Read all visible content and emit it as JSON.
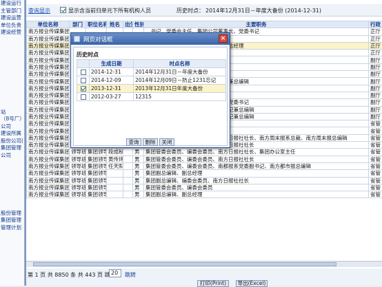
{
  "left_nav": {
    "items": [
      "建设运行",
      "主管部门",
      "建设运营",
      "单位负责",
      "建设经营",
      "",
      "",
      "",
      "",
      "",
      "",
      "",
      "",
      "",
      "",
      "站",
      "（8号厂）",
      "公司",
      "建设所属",
      "股份公司(",
      "集团管理",
      "公司",
      "",
      "",
      "",
      "",
      "",
      "",
      "",
      "股份管理",
      "集团管理",
      "管理计划"
    ]
  },
  "query_bar": {
    "link": "查询显示",
    "checkbox_label": "显示含当前归单元下所有机构人员",
    "history_label": "历史时点：",
    "history_value": "2014年12月31日－年度大备份 (2014-12-31)"
  },
  "table": {
    "headers": [
      "单位名称",
      "部门",
      "职位名称",
      "姓名",
      "出生",
      "性别",
      "主要职务",
      "行政"
    ],
    "rows": [
      {
        "c": [
          "南方报业传媒集团",
          "",
          "",
          "",
          "",
          "",
          "…书记、党委会主任、集团公司董事长、党委书记",
          "正厅"
        ],
        "hl": false
      },
      {
        "c": [
          "南方报业传媒集团",
          "",
          "",
          "",
          "",
          "",
          "…集团副总编辑、南方日报社社长",
          "正厅"
        ],
        "hl": false
      },
      {
        "c": [
          "南方报业传媒集团",
          "",
          "",
          "",
          "",
          "",
          "…工作；集团公司党委书记、董事、总经理",
          "正厅"
        ],
        "hl": true
      },
      {
        "c": [
          "南方报业传媒集团",
          "",
          "",
          "",
          "",
          "",
          "…集团副总编辑、南方日报社总编辑",
          "正厅"
        ],
        "hl": false
      },
      {
        "c": [
          "南方报业传媒集团",
          "",
          "",
          "",
          "",
          "",
          "管理会副主任",
          "副厅"
        ],
        "hl": false
      },
      {
        "c": [
          "南方报业传媒集团",
          "",
          "",
          "",
          "",
          "",
          "集团副总编辑、南方都市报总编辑",
          "副厅"
        ],
        "hl": false
      },
      {
        "c": [
          "南方报业传媒集团",
          "",
          "",
          "",
          "",
          "",
          "集团副总编辑、南方日报社副总编辑",
          "副厅"
        ],
        "hl": false
      },
      {
        "c": [
          "南方报业传媒集团",
          "",
          "",
          "",
          "",
          "",
          "集团副总编辑、南都报系党委副书记兼总编辑",
          "副厅"
        ],
        "hl": false
      },
      {
        "c": [
          "南方报业传媒集团",
          "",
          "",
          "",
          "",
          "",
          "集团副总编辑、南方农村报社社长",
          "副厅"
        ],
        "hl": false
      },
      {
        "c": [
          "南方报业传媒集团",
          "",
          "",
          "",
          "",
          "",
          "集团副总编辑、21世纪报系党委书记",
          "副厅"
        ],
        "hl": false
      },
      {
        "c": [
          "南方报业传媒集团",
          "",
          "",
          "",
          "",
          "",
          "集团副总编辑、南方周末报系总裁兼党委书记",
          "副厅"
        ],
        "hl": false
      },
      {
        "c": [
          "南方报业传媒集团",
          "",
          "",
          "",
          "",
          "",
          "集团副总编辑、南方杂志社党委副书记兼总编辑",
          "副厅"
        ],
        "hl": false
      },
      {
        "c": [
          "南方报业传媒集团",
          "",
          "",
          "",
          "",
          "",
          "集团副总编辑、南方都市网党委副书记兼总编辑",
          "副厅"
        ],
        "hl": false
      },
      {
        "c": [
          "南方报业传媒集团",
          "",
          "",
          "",
          "",
          "",
          "集团公司副董事、副总经理",
          "省管"
        ],
        "hl": false
      },
      {
        "c": [
          "南方报业传媒集团",
          "领导班子",
          "集团领导",
          "任俊之",
          "",
          "男",
          "集团公司党委委员、副总经理",
          "省管"
        ],
        "hl": false
      },
      {
        "c": [
          "南方报业传媒集团",
          "领导班子",
          "集团领导",
          "王晖",
          "",
          "男",
          "集团管委会委员、编委会委员、南方日报社社长、南方周末报系总裁、南方周末报总编辑",
          "省管"
        ],
        "hl": false
      },
      {
        "c": [
          "南方报业传媒集团",
          "领导班子",
          "集团领导",
          "曾庆权",
          "",
          "男",
          "集团管委会委员、编委会委员、南方日报社社长",
          "省管"
        ],
        "hl": false
      },
      {
        "c": [
          "南方报业传媒集团",
          "领导班子",
          "集团领导",
          "段成秋",
          "",
          "男",
          "集团管委会委员、编委会委员、南方日报社社长、集团办公室主任",
          "省管"
        ],
        "hl": false
      },
      {
        "c": [
          "南方报业传媒集团",
          "领导班子",
          "集团领导",
          "黄传炜",
          "",
          "男",
          "集团管委会委员、编委会委员、南方日报社社长",
          "省管"
        ],
        "hl": false
      },
      {
        "c": [
          "南方报业传媒集团",
          "领导班子",
          "集团领导",
          "任天阳",
          "",
          "男",
          "集团管委会委员、编委会委员、南都报系党委副书记、南方都市报总编辑",
          "省管"
        ],
        "hl": false
      },
      {
        "c": [
          "南方报业传媒集团",
          "领导班子",
          "集团领导",
          "",
          "",
          "男",
          "集团副总编辑、副总经理",
          "省管"
        ],
        "hl": false
      },
      {
        "c": [
          "南方报业传媒集团",
          "领导班子",
          "集团领导",
          "",
          "",
          "男",
          "集团副总编辑、编委会委员、南方日报社社长",
          "省管"
        ],
        "hl": false
      },
      {
        "c": [
          "南方报业传媒集团",
          "领导班子",
          "集团领导",
          "",
          "",
          "男",
          "集团管委会委员、编委会委员",
          "省管"
        ],
        "hl": false
      },
      {
        "c": [
          "南方报业传媒集团",
          "领导班子",
          "集团领导",
          "",
          "",
          "男",
          "集团副总编辑、副总经理",
          "省管"
        ],
        "hl": false
      }
    ]
  },
  "pager": {
    "text": "第 1 页 共 8850 条 共 443 页 跳到",
    "page_input": "20",
    "go_label": "跳转",
    "btn_left": "打印(Print)",
    "btn_right": "导出(Excel)"
  },
  "dialog": {
    "title": "网页对话框",
    "close_label": "×",
    "heading": "历史时点",
    "headers": [
      "",
      "生成日期",
      "时点名称"
    ],
    "rows": [
      {
        "checked": false,
        "date": "2014-12-31",
        "name": "2014年12月31日－年度大备份",
        "sel": false
      },
      {
        "checked": false,
        "date": "2014-12-09",
        "name": "2014年12月09日－防止1231忘记",
        "sel": false
      },
      {
        "checked": true,
        "date": "2013-12-31",
        "name": "2013年12月31日年度大备份",
        "sel": true
      },
      {
        "checked": false,
        "date": "2012-03-27",
        "name": "12315",
        "sel": false
      }
    ],
    "btn_query": "查询",
    "btn_delete": "删除",
    "btn_close": "关闭"
  }
}
